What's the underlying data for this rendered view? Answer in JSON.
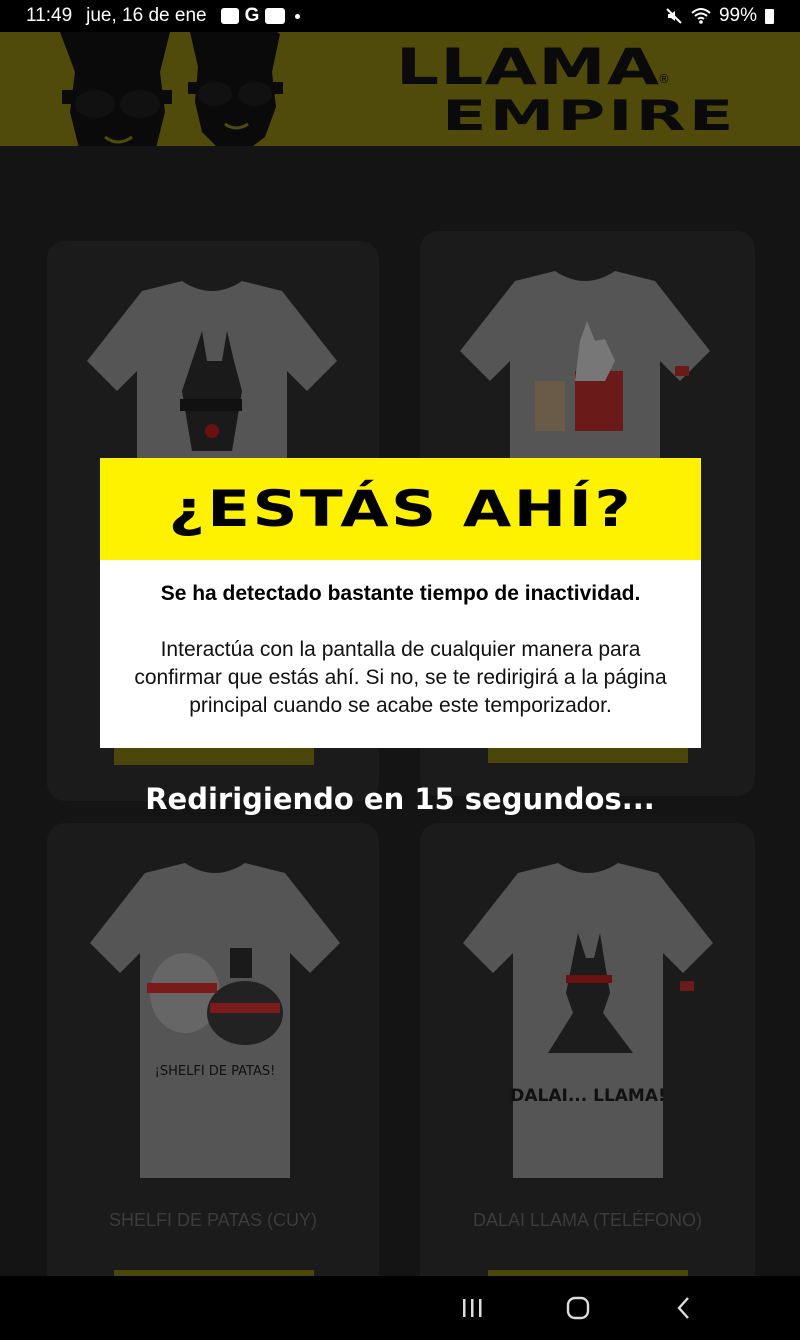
{
  "status_bar": {
    "time": "11:49",
    "date": "jue, 16 de ene",
    "notification_icons": [
      "gallery-icon",
      "google-icon",
      "youtube-icon",
      "dot-icon"
    ],
    "google_letter": "G",
    "battery": "99%",
    "right_icons": [
      "mute-icon",
      "wifi-icon",
      "battery-icon"
    ]
  },
  "header": {
    "brand_line1": "LLAMA",
    "brand_line2": "EMPIRE",
    "registered_mark": "®",
    "colors": {
      "background": "#fff200",
      "text": "#000000"
    }
  },
  "products": [
    {
      "name": "",
      "image": "tshirt-llama-red-nose"
    },
    {
      "name": "",
      "image": "tshirt-shelfi-de-patas-peru"
    },
    {
      "name": "SHELFI DE PATAS (CUY)",
      "image": "tshirt-llama-cuy-selfie",
      "print_text": "¡SHELFI DE PATAS!"
    },
    {
      "name": "DALAI LLAMA (TELÉFONO)",
      "image": "tshirt-dalai-llama",
      "print_text": "DALAI... LLAMA!"
    }
  ],
  "modal": {
    "title": "¿ESTÁS AHÍ?",
    "subtitle": "Se ha detectado bastante tiempo de inactividad.",
    "body": "Interactúa con la pantalla de cualquier manera para confirmar que estás ahí. Si no, se te redirigirá a la página principal cuando se acabe este temporizador."
  },
  "redirect_text": "Redirigiendo en 15 segundos...",
  "nav_bar": {
    "recents": "recents-icon",
    "home": "home-icon",
    "back": "back-icon"
  }
}
